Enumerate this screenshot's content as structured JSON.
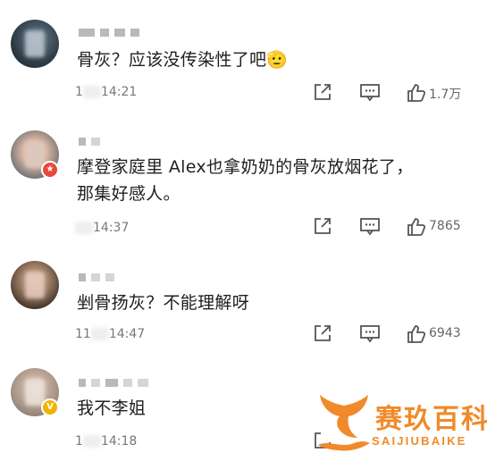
{
  "comments": [
    {
      "text": "骨灰？应该没传染性了吧🫡",
      "time": "14:21",
      "time_prefix": "1",
      "likes": "1.7万",
      "badge": ""
    },
    {
      "text": "摩登家庭里 Alex也拿奶奶的骨灰放烟花了，那集好感人。",
      "time": "14:37",
      "time_prefix": "",
      "likes": "7865",
      "badge": "★"
    },
    {
      "text": "剉骨扬灰？不能理解呀",
      "time": "14:47",
      "time_prefix": "11",
      "likes": "6943",
      "badge": ""
    },
    {
      "text": "我不李姐",
      "time": "14:18",
      "time_prefix": "1",
      "likes": "",
      "badge": "V"
    }
  ],
  "icons": {
    "share": "share-icon",
    "comment": "comment-icon",
    "like": "thumbs-up-icon"
  },
  "watermark": {
    "cn": "赛玖百科",
    "en": "SAIJIUBAIKE",
    "color": "#f08a2a"
  }
}
